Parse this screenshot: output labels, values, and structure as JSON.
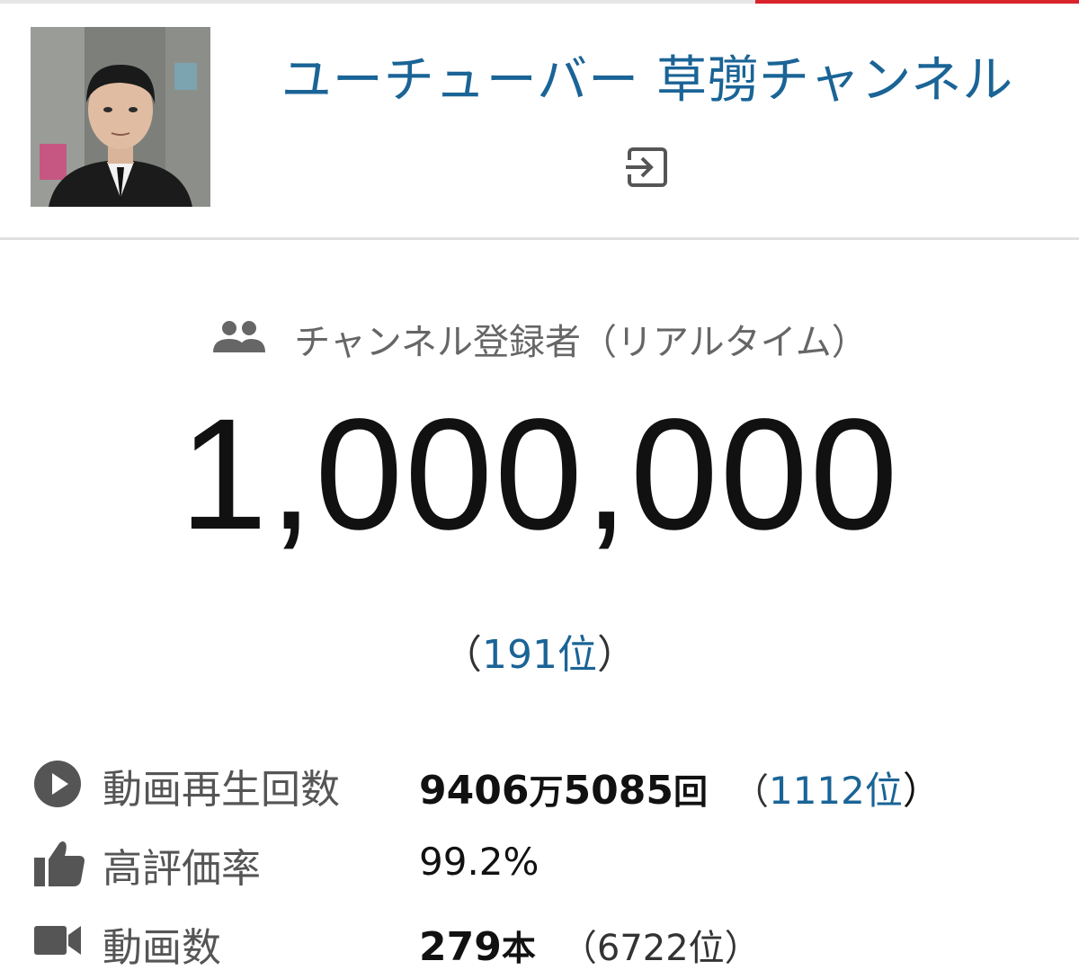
{
  "header": {
    "channel_title": "ユーチューバー 草彅チャンネル",
    "avatar_alt": "channel-avatar",
    "signin_icon": "login-icon",
    "accent_color": "#d9232d",
    "title_color": "#1a6496"
  },
  "subscribers": {
    "icon": "people-icon",
    "label": "チャンネル登録者（リアルタイム）",
    "count": "1,000,000",
    "rank_open": "（",
    "rank": "191位",
    "rank_close": "）"
  },
  "stats": [
    {
      "icon": "play-circle-icon",
      "label": "動画再生回数",
      "value_num1": "9406",
      "value_unit1": "万",
      "value_num2": "5085",
      "value_unit2": "回",
      "rank_open": "（",
      "rank": "1112位",
      "rank_close": "）"
    },
    {
      "icon": "thumbs-up-icon",
      "label": "高評価率",
      "value": "99.2%"
    },
    {
      "icon": "video-camera-icon",
      "label": "動画数",
      "value_num": "279",
      "value_unit": "本",
      "rank_text": "（6722位）"
    }
  ]
}
